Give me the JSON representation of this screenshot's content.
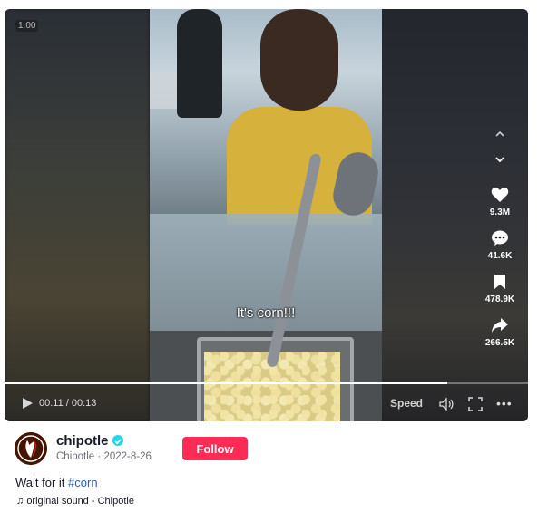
{
  "player": {
    "speed_badge": "1.00",
    "caption": "It's corn!!!",
    "time": "00:11 / 00:13",
    "progress": 0.846,
    "speed_label": "Speed",
    "actions": [
      {
        "icon": "heart-icon",
        "count": "9.3M"
      },
      {
        "icon": "comment-icon",
        "count": "41.6K"
      },
      {
        "icon": "bookmark-icon",
        "count": "478.9K"
      },
      {
        "icon": "share-icon",
        "count": "266.5K"
      }
    ]
  },
  "author": {
    "username": "chipotle",
    "display_name": "Chipotle",
    "date": "2022-8-26",
    "follow_label": "Follow"
  },
  "description": {
    "text": "Wait for it ",
    "hashtag": "#corn"
  },
  "sound": "original sound - Chipotle",
  "colors": {
    "follow": "#fe2c55",
    "verified": "#20d5ec",
    "hashtag": "#2b5db9"
  }
}
